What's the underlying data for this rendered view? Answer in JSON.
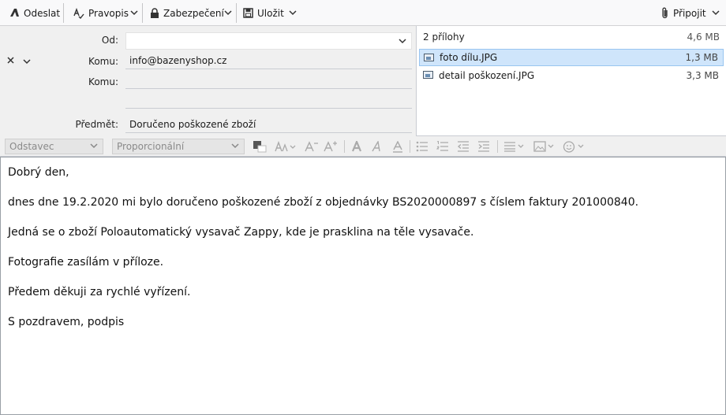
{
  "toolbar": {
    "send_label": "Odeslat",
    "spell_label": "Pravopis",
    "security_label": "Zabezpečení",
    "save_label": "Uložit",
    "attach_label": "Připojit"
  },
  "header": {
    "from_label": "Od:",
    "from_value": "",
    "to_label_1": "Komu:",
    "to_value_1": "info@bazenyshop.cz",
    "to_label_2": "Komu:",
    "to_value_2": "",
    "subject_label": "Předmět:",
    "subject_value": "Doručeno poškozené zboží"
  },
  "attachments": {
    "count_label": "2 přílohy",
    "total_size": "4,6 MB",
    "items": [
      {
        "name": "foto dílu.JPG",
        "size": "1,3 MB",
        "selected": true
      },
      {
        "name": "detail poškození.JPG",
        "size": "3,3 MB",
        "selected": false
      }
    ]
  },
  "format_bar": {
    "paragraph_select": "Odstavec",
    "font_select": "Proporcionální"
  },
  "body": {
    "lines": [
      "Dobrý den,",
      "dnes dne 19.2.2020 mi bylo doručeno poškozené zboží z objednávky BS2020000897 s číslem faktury 201000840.",
      "Jedná se o zboží Poloautomatický vysavač Zappy, kde je prasklina na těle vysavače.",
      "Fotografie zasílám v příloze.",
      "Předem děkuji za rychlé vyřízení.",
      "S pozdravem, podpis"
    ]
  },
  "icons": {
    "send": "send-icon",
    "spell": "spellcheck-icon",
    "security": "lock-icon",
    "save": "save-icon",
    "attach": "paperclip-icon"
  }
}
